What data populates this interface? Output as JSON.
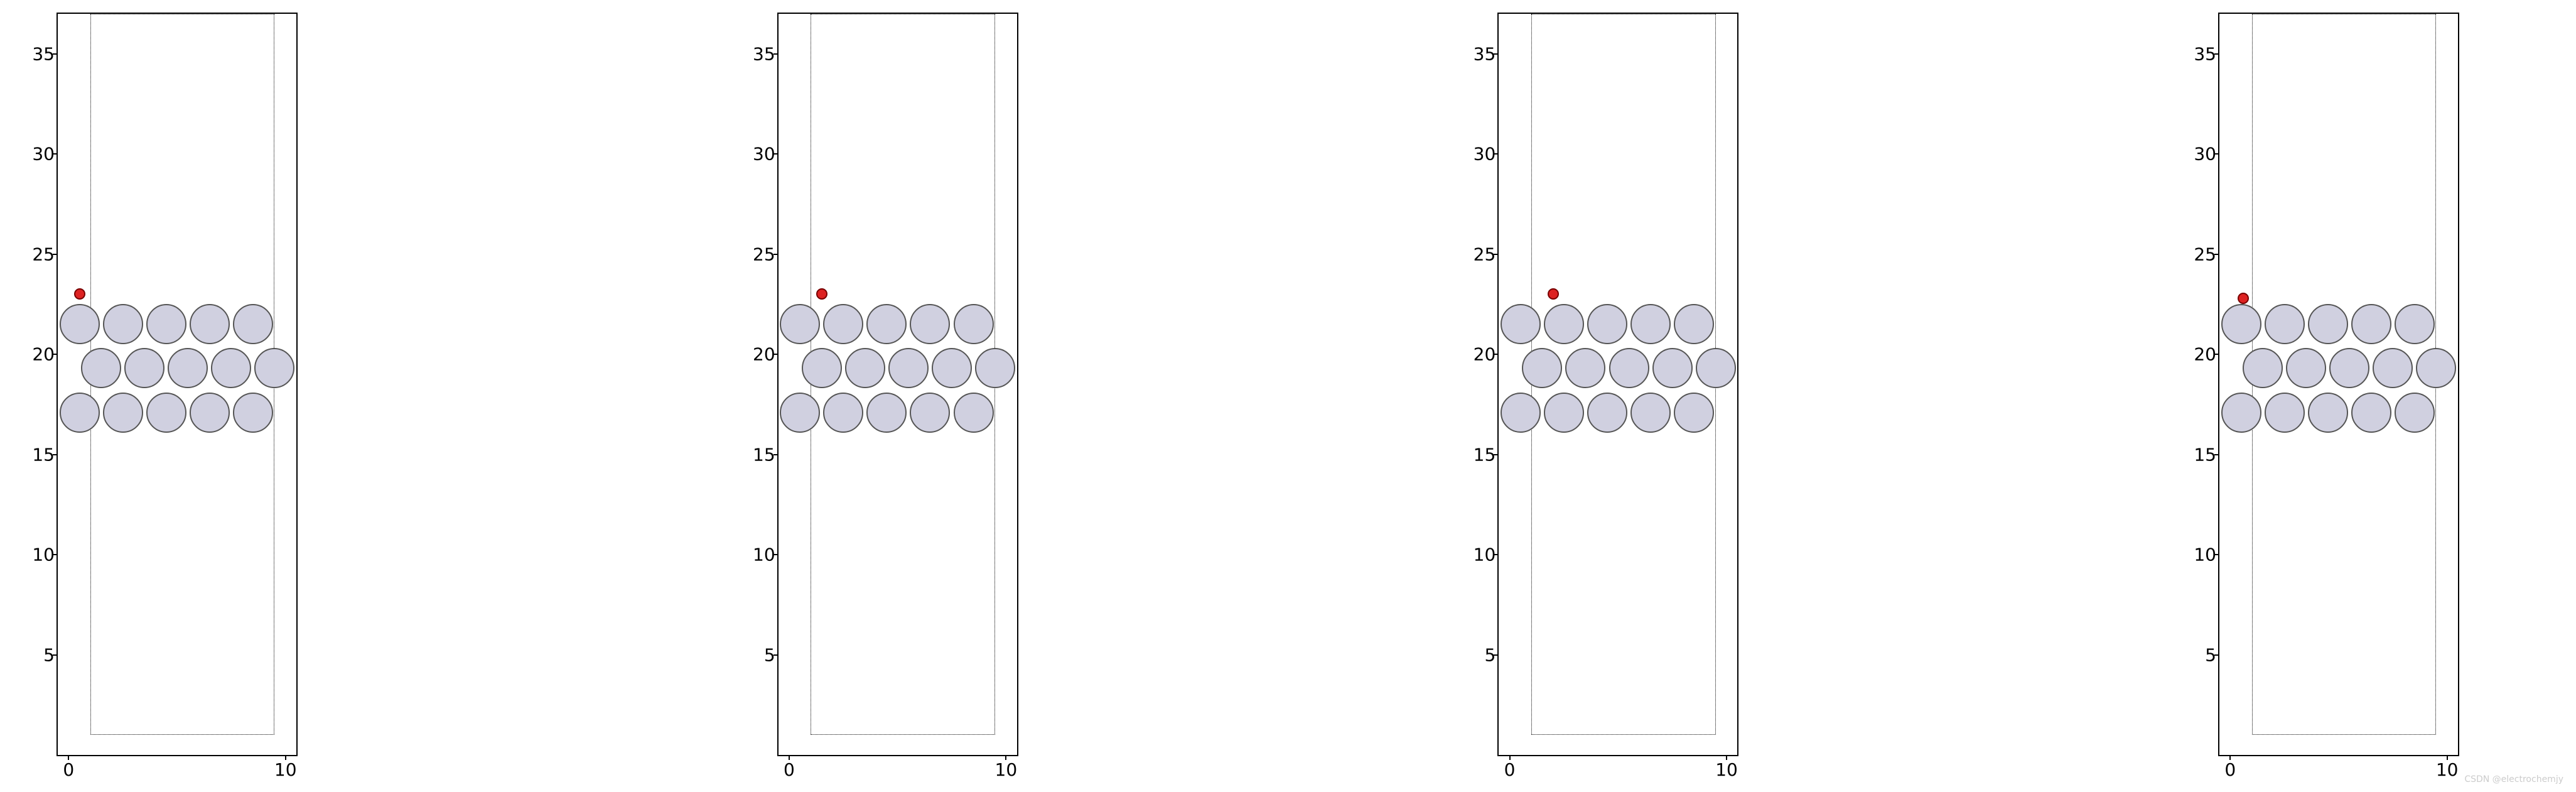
{
  "chart_data": [
    {
      "type": "scatter",
      "xlim": [
        -0.5,
        10.5
      ],
      "ylim": [
        0,
        37
      ],
      "xticks": [
        0,
        10
      ],
      "yticks": [
        5,
        10,
        15,
        20,
        25,
        30,
        35
      ],
      "box": {
        "x0": 1,
        "y0": 1,
        "x1": 9.5,
        "y1": 37
      },
      "particles": [
        {
          "x": 0.5,
          "y": 21.5
        },
        {
          "x": 2.5,
          "y": 21.5
        },
        {
          "x": 4.5,
          "y": 21.5
        },
        {
          "x": 6.5,
          "y": 21.5
        },
        {
          "x": 8.5,
          "y": 21.5
        },
        {
          "x": 1.5,
          "y": 19.3
        },
        {
          "x": 3.5,
          "y": 19.3
        },
        {
          "x": 5.5,
          "y": 19.3
        },
        {
          "x": 7.5,
          "y": 19.3
        },
        {
          "x": 9.5,
          "y": 19.3
        },
        {
          "x": 0.5,
          "y": 17.1
        },
        {
          "x": 2.5,
          "y": 17.1
        },
        {
          "x": 4.5,
          "y": 17.1
        },
        {
          "x": 6.5,
          "y": 17.1
        },
        {
          "x": 8.5,
          "y": 17.1
        }
      ],
      "red_point": {
        "x": 0.5,
        "y": 23.0
      }
    },
    {
      "type": "scatter",
      "xlim": [
        -0.5,
        10.5
      ],
      "ylim": [
        0,
        37
      ],
      "xticks": [
        0,
        10
      ],
      "yticks": [
        5,
        10,
        15,
        20,
        25,
        30,
        35
      ],
      "box": {
        "x0": 1,
        "y0": 1,
        "x1": 9.5,
        "y1": 37
      },
      "particles": [
        {
          "x": 0.5,
          "y": 21.5
        },
        {
          "x": 2.5,
          "y": 21.5
        },
        {
          "x": 4.5,
          "y": 21.5
        },
        {
          "x": 6.5,
          "y": 21.5
        },
        {
          "x": 8.5,
          "y": 21.5
        },
        {
          "x": 1.5,
          "y": 19.3
        },
        {
          "x": 3.5,
          "y": 19.3
        },
        {
          "x": 5.5,
          "y": 19.3
        },
        {
          "x": 7.5,
          "y": 19.3
        },
        {
          "x": 9.5,
          "y": 19.3
        },
        {
          "x": 0.5,
          "y": 17.1
        },
        {
          "x": 2.5,
          "y": 17.1
        },
        {
          "x": 4.5,
          "y": 17.1
        },
        {
          "x": 6.5,
          "y": 17.1
        },
        {
          "x": 8.5,
          "y": 17.1
        }
      ],
      "red_point": {
        "x": 1.5,
        "y": 23.0
      }
    },
    {
      "type": "scatter",
      "xlim": [
        -0.5,
        10.5
      ],
      "ylim": [
        0,
        37
      ],
      "xticks": [
        0,
        10
      ],
      "yticks": [
        5,
        10,
        15,
        20,
        25,
        30,
        35
      ],
      "box": {
        "x0": 1,
        "y0": 1,
        "x1": 9.5,
        "y1": 37
      },
      "particles": [
        {
          "x": 0.5,
          "y": 21.5
        },
        {
          "x": 2.5,
          "y": 21.5
        },
        {
          "x": 4.5,
          "y": 21.5
        },
        {
          "x": 6.5,
          "y": 21.5
        },
        {
          "x": 8.5,
          "y": 21.5
        },
        {
          "x": 1.5,
          "y": 19.3
        },
        {
          "x": 3.5,
          "y": 19.3
        },
        {
          "x": 5.5,
          "y": 19.3
        },
        {
          "x": 7.5,
          "y": 19.3
        },
        {
          "x": 9.5,
          "y": 19.3
        },
        {
          "x": 0.5,
          "y": 17.1
        },
        {
          "x": 2.5,
          "y": 17.1
        },
        {
          "x": 4.5,
          "y": 17.1
        },
        {
          "x": 6.5,
          "y": 17.1
        },
        {
          "x": 8.5,
          "y": 17.1
        }
      ],
      "red_point": {
        "x": 2.0,
        "y": 23.0
      }
    },
    {
      "type": "scatter",
      "xlim": [
        -0.5,
        10.5
      ],
      "ylim": [
        0,
        37
      ],
      "xticks": [
        0,
        10
      ],
      "yticks": [
        5,
        10,
        15,
        20,
        25,
        30,
        35
      ],
      "box": {
        "x0": 1,
        "y0": 1,
        "x1": 9.5,
        "y1": 37
      },
      "particles": [
        {
          "x": 0.5,
          "y": 21.5
        },
        {
          "x": 2.5,
          "y": 21.5
        },
        {
          "x": 4.5,
          "y": 21.5
        },
        {
          "x": 6.5,
          "y": 21.5
        },
        {
          "x": 8.5,
          "y": 21.5
        },
        {
          "x": 1.5,
          "y": 19.3
        },
        {
          "x": 3.5,
          "y": 19.3
        },
        {
          "x": 5.5,
          "y": 19.3
        },
        {
          "x": 7.5,
          "y": 19.3
        },
        {
          "x": 9.5,
          "y": 19.3
        },
        {
          "x": 0.5,
          "y": 17.1
        },
        {
          "x": 2.5,
          "y": 17.1
        },
        {
          "x": 4.5,
          "y": 17.1
        },
        {
          "x": 6.5,
          "y": 17.1
        },
        {
          "x": 8.5,
          "y": 17.1
        }
      ],
      "red_point": {
        "x": 0.6,
        "y": 22.8
      }
    }
  ],
  "watermark": "CSDN @electrochemjy"
}
